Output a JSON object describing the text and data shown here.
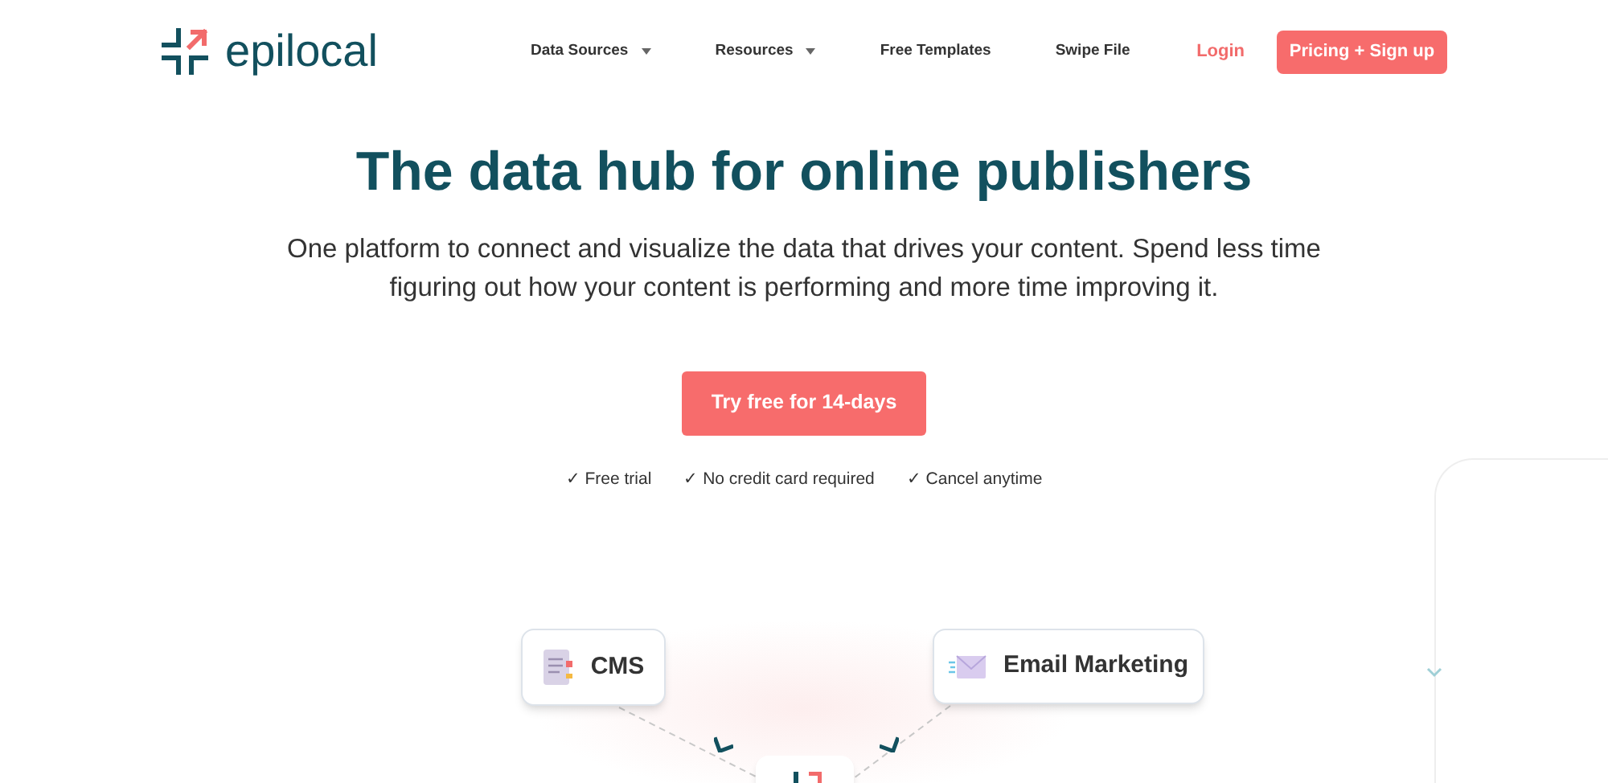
{
  "logo": {
    "text": "epilocal"
  },
  "nav": [
    {
      "label": "Data Sources",
      "kind": "dropdown"
    },
    {
      "label": "Resources",
      "kind": "dropdown"
    },
    {
      "label": "Free Templates",
      "kind": "link"
    },
    {
      "label": "Swipe File",
      "kind": "link"
    }
  ],
  "login": "Login",
  "signup": "Pricing + Sign up",
  "hero": {
    "title": "The data hub for online publishers",
    "subtitle": "One platform to connect and visualize the data that drives your content. Spend less time figuring out how your content is performing and more time improving it.",
    "cta": "Try free for 14-days",
    "perks": [
      "✓ Free trial",
      "✓ No credit card required",
      "✓ Cancel anytime"
    ]
  },
  "diagram": {
    "nodes": [
      {
        "label": "CMS",
        "kind": "document"
      },
      {
        "label": "Email Marketing",
        "kind": "email"
      }
    ]
  }
}
